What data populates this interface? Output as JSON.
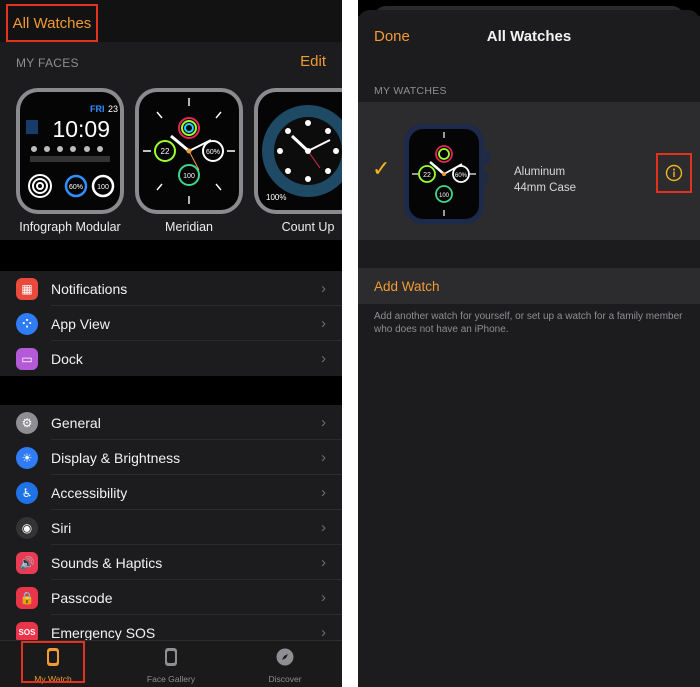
{
  "left": {
    "top_link": "All Watches",
    "faces_title": "MY FACES",
    "edit_label": "Edit",
    "faces": [
      {
        "name": "Infograph Modular",
        "day": "FRI",
        "date": "23",
        "time": "10:09",
        "r1": "60%",
        "r2": "100"
      },
      {
        "name": "Meridian",
        "c1": "22",
        "c2": "60%",
        "c3": "100"
      },
      {
        "name": "Count Up",
        "c1": "100%"
      }
    ],
    "group1": [
      {
        "label": "Notifications",
        "icon": "calendar-icon",
        "color": "#ea4a3c"
      },
      {
        "label": "App View",
        "icon": "app-grid-icon",
        "color": "#2f7cf6"
      },
      {
        "label": "Dock",
        "icon": "dock-icon",
        "color": "#b45ad6"
      }
    ],
    "group2": [
      {
        "label": "General",
        "icon": "gear-icon",
        "color": "#8e8e93"
      },
      {
        "label": "Display & Brightness",
        "icon": "sun-icon",
        "color": "#2f7cf6"
      },
      {
        "label": "Accessibility",
        "icon": "accessibility-icon",
        "color": "#1f73e6"
      },
      {
        "label": "Siri",
        "icon": "siri-icon",
        "color": "#333"
      },
      {
        "label": "Sounds & Haptics",
        "icon": "speaker-icon",
        "color": "#ea3b55"
      },
      {
        "label": "Passcode",
        "icon": "lock-icon",
        "color": "#e9344a"
      },
      {
        "label": "Emergency SOS",
        "icon": "sos-icon",
        "color": "#e9344a",
        "icon_text": "SOS"
      }
    ],
    "tabs": [
      {
        "label": "My Watch",
        "icon": "watch-icon"
      },
      {
        "label": "Face Gallery",
        "icon": "face-gallery-icon"
      },
      {
        "label": "Discover",
        "icon": "compass-icon"
      }
    ]
  },
  "right": {
    "done_label": "Done",
    "title": "All Watches",
    "section_title": "MY WATCHES",
    "watch": {
      "material": "Aluminum",
      "size": "44mm Case",
      "c1": "22",
      "c2": "60%",
      "c3": "100"
    },
    "add_label": "Add Watch",
    "add_description": "Add another watch for yourself, or set up a watch for a family member who does not have an iPhone."
  },
  "colors": {
    "accent": "#f29a34",
    "highlight": "#e3331f",
    "check": "#f2b51d"
  }
}
